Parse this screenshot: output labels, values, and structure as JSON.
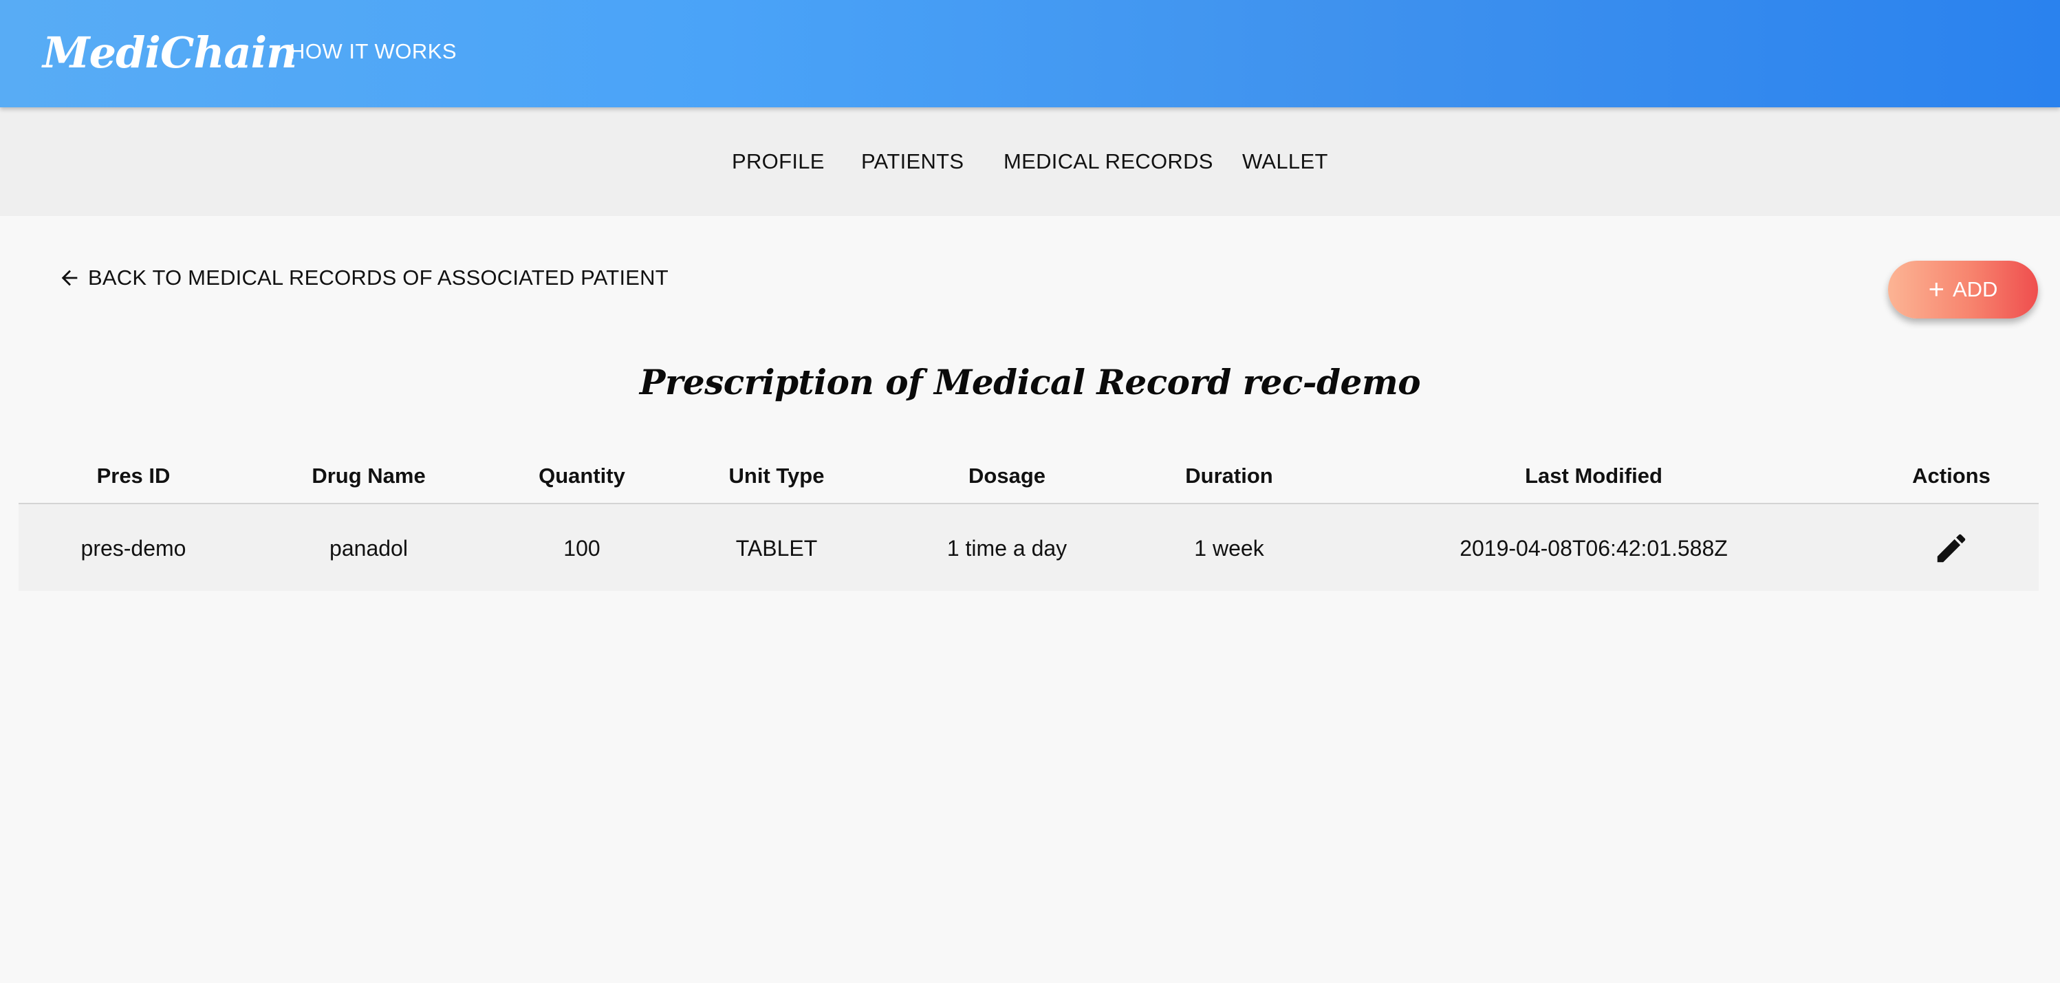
{
  "header": {
    "brand": "MediChain",
    "how_it_works": "HOW IT WORKS"
  },
  "subnav": {
    "items": [
      "PROFILE",
      "PATIENTS",
      "MEDICAL RECORDS",
      "WALLET"
    ]
  },
  "actions": {
    "back_label": "BACK TO MEDICAL RECORDS OF ASSOCIATED PATIENT",
    "add_label": "ADD"
  },
  "page": {
    "title": "Prescription of Medical Record rec-demo"
  },
  "table": {
    "columns": [
      "Pres ID",
      "Drug Name",
      "Quantity",
      "Unit Type",
      "Dosage",
      "Duration",
      "Last Modified",
      "Actions"
    ],
    "rows": [
      {
        "pres_id": "pres-demo",
        "drug_name": "panadol",
        "quantity": "100",
        "unit_type": "TABLET",
        "dosage": "1 time a day",
        "duration": "1 week",
        "last_modified": "2019-04-08T06:42:01.588Z"
      }
    ]
  },
  "icons": {
    "back": "arrow-left-icon",
    "add": "plus-icon",
    "edit": "pencil-icon"
  },
  "colors": {
    "header_gradient_start": "#58acf5",
    "header_gradient_end": "#2a82ee",
    "add_gradient_start": "#fcb494",
    "add_gradient_end": "#ef4e4e",
    "subnav_bg": "#efefef",
    "page_bg": "#f8f8f8"
  }
}
